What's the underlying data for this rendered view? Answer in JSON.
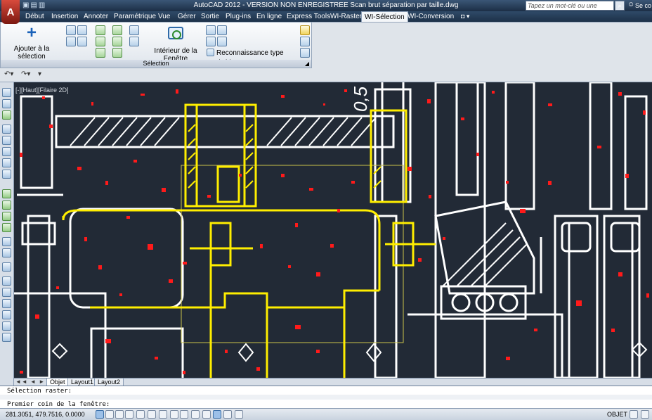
{
  "titlebar": {
    "app_letter": "A",
    "title": "AutoCAD 2012 - VERSION NON ENREGISTREE    Scan brut séparation par taille.dwg",
    "search_placeholder": "Tapez un mot-clé ou une expression",
    "user_label": "Se co"
  },
  "menu": {
    "tabs": [
      "Début",
      "Insertion",
      "Annoter",
      "Paramétrique",
      "Vue",
      "Gérer",
      "Sortie",
      "Plug-ins",
      "En ligne",
      "Express Tools",
      "WI-Raster",
      "WI-Sélection",
      "WI-Conversion"
    ],
    "active_tab": "WI-Sélection"
  },
  "ribbon": {
    "add_selection": "Ajouter à la sélection",
    "interior_window": "Intérieur de la Fenêtre",
    "object_recognition": "Reconnaissance type d'objet",
    "group_label": "Sélection"
  },
  "viewport": {
    "label": "[-][Haut][Filaire 2D]",
    "dimension_text": "0,5"
  },
  "layout_tabs": {
    "nav": "◄◄ ◄ ► ►►",
    "tabs": [
      "Objet",
      "Layout1",
      "Layout2"
    ],
    "active": "Objet"
  },
  "command": {
    "line1": "Sélection raster:",
    "line2": "Premier coin de la fenêtre:"
  },
  "status": {
    "coordinates": "281.3051, 479.7516, 0.0000",
    "mode": "OBJET"
  },
  "colors": {
    "canvas_bg": "#222a36",
    "drawing_white": "#ffffff",
    "selection_yellow": "#ffee00",
    "noise_red": "#ff1a1a"
  }
}
